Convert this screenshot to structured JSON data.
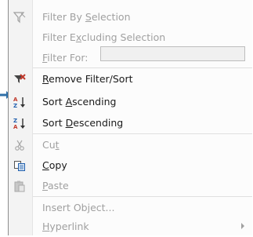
{
  "menu": {
    "items": [
      {
        "id": "filter-by-selection",
        "pre": "Filter By ",
        "acc": "S",
        "post": "election",
        "disabled": true,
        "icon": "filter-selection-icon"
      },
      {
        "id": "filter-excluding",
        "pre": "Filter E",
        "acc": "x",
        "post": "cluding Selection",
        "disabled": true,
        "icon": ""
      },
      {
        "id": "filter-for",
        "pre": "",
        "acc": "F",
        "post": "ilter For:",
        "disabled": true,
        "icon": ""
      },
      {
        "id": "remove-filter",
        "pre": "",
        "acc": "R",
        "post": "emove Filter/Sort",
        "disabled": false,
        "icon": "remove-filter-icon"
      },
      {
        "id": "sort-asc",
        "pre": "Sort ",
        "acc": "A",
        "post": "scending",
        "disabled": false,
        "icon": "sort-ascending-icon"
      },
      {
        "id": "sort-desc",
        "pre": "Sort ",
        "acc": "D",
        "post": "escending",
        "disabled": false,
        "icon": "sort-descending-icon"
      },
      {
        "id": "cut",
        "pre": "Cu",
        "acc": "t",
        "post": "",
        "disabled": true,
        "icon": "scissors-icon"
      },
      {
        "id": "copy",
        "pre": "",
        "acc": "C",
        "post": "opy",
        "disabled": false,
        "icon": "copy-icon"
      },
      {
        "id": "paste",
        "pre": "",
        "acc": "P",
        "post": "aste",
        "disabled": true,
        "icon": "paste-icon"
      },
      {
        "id": "insert-object",
        "pre": "Insert Object...",
        "acc": "",
        "post": "",
        "disabled": true,
        "icon": ""
      },
      {
        "id": "hyperlink",
        "pre": "",
        "acc": "H",
        "post": "yperlink",
        "disabled": true,
        "icon": ""
      }
    ],
    "filter_for_value": ""
  },
  "colors": {
    "accent_red": "#c0392b",
    "icon_blue": "#1f5fae",
    "disabled": "#a0a0a0"
  }
}
